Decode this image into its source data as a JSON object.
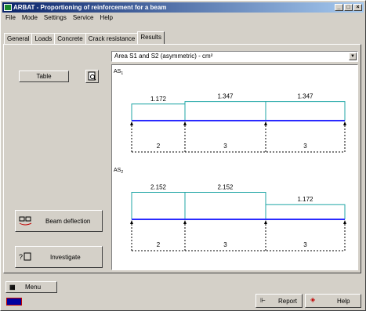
{
  "title": "ARBAT - Proportioning of reinforcement for a beam",
  "menu": [
    "File",
    "Mode",
    "Settings",
    "Service",
    "Help"
  ],
  "tabs": [
    "General",
    "Loads",
    "Concrete",
    "Crack resistance",
    "Results"
  ],
  "active_tab": "Results",
  "left": {
    "table_label": "Table",
    "beam_deflection_label": "Beam deflection",
    "investigate_label": "Investigate"
  },
  "dropdown_value": "Area S1 and S2 (asymmetric) - cm²",
  "chart_top": {
    "label": "AS1",
    "spans": [
      1.172,
      1.347,
      1.347
    ],
    "span_labels": [
      "1.172",
      "1.347",
      "1.347"
    ],
    "bar_counts": [
      "2",
      "3",
      "3"
    ]
  },
  "chart_bottom": {
    "label": "AS2",
    "spans": [
      2.152,
      2.152,
      1.172
    ],
    "span_labels": [
      "2.152",
      "2.152",
      "1.172"
    ],
    "bar_counts": [
      "2",
      "3",
      "3"
    ]
  },
  "bottom": {
    "menu_label": "Menu",
    "report_label": "Report",
    "help_label": "Help"
  },
  "colors": {
    "area_line": "#1fa5a5",
    "beam": "#2a2aff"
  }
}
